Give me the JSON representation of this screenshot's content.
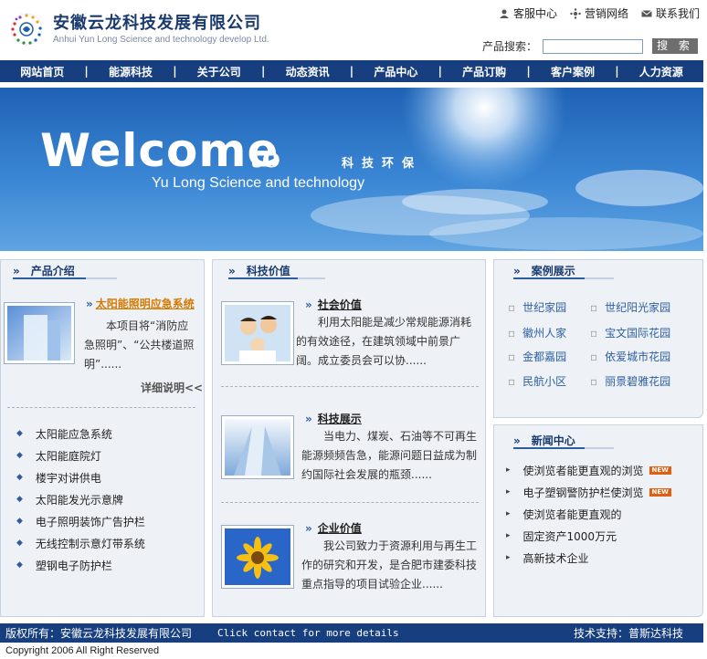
{
  "header": {
    "company_cn": "安徽云龙科技发展有限公司",
    "company_en": "Anhui Yun Long Science and technology develop Ltd.",
    "links": [
      "客服中心",
      "营销网络",
      "联系我们"
    ],
    "search_label": "产品搜索：",
    "search_value": "",
    "search_button": "搜 索"
  },
  "nav": [
    "网站首页",
    "能源科技",
    "关于公司",
    "动态资讯",
    "产品中心",
    "产品订购",
    "客户案例",
    "人力资源"
  ],
  "banner": {
    "welcome": "Welcome",
    "to": "to",
    "tagline": "科技环保",
    "subtitle": "Yu Long Science and technology"
  },
  "products": {
    "title": "产品介绍",
    "featured_title": "太阳能照明应急系统",
    "featured_text": "本项目将“消防应急照明”、“公共楼道照明”......",
    "more": "详细说明<<",
    "items": [
      "太阳能应急系统",
      "太阳能庭院灯",
      "楼宇对讲供电",
      "太阳能发光示意牌",
      "电子照明装饰广告护栏",
      "无线控制示意灯带系统",
      "塑钢电子防护栏"
    ]
  },
  "tech": {
    "title": "科技价值",
    "entries": [
      {
        "heading": "社会价值",
        "text": "利用太阳能是减少常规能源消耗的有效途径，在建筑领域中前景广阔。成立委员会可以协......"
      },
      {
        "heading": "科技展示",
        "text": "当电力、煤炭、石油等不可再生能源频频告急，能源问题日益成为制约国际社会发展的瓶颈......"
      },
      {
        "heading": "企业价值",
        "text": "我公司致力于资源利用与再生工作的研究和开发，是合肥市建委科技重点指导的项目试验企业......"
      }
    ]
  },
  "cases": {
    "title": "案例展示",
    "items": [
      "世纪家园",
      "世纪阳光家园",
      "徽州人家",
      "宝文国际花园",
      "金都嘉园",
      "依爱城市花园",
      "民航小区",
      "丽景碧雅花园"
    ]
  },
  "news": {
    "title": "新闻中心",
    "items": [
      {
        "text": "使浏览者能更直观的浏览",
        "badge": "NEW"
      },
      {
        "text": "电子塑钢警防护栏使浏览",
        "badge": "NEW"
      },
      {
        "text": "使浏览者能更直观的",
        "badge": ""
      },
      {
        "text": "固定资产1000万元",
        "badge": ""
      },
      {
        "text": "高新技术企业",
        "badge": ""
      }
    ]
  },
  "footer": {
    "rights": "版权所有：安徽云龙科技发展有限公司",
    "click": "Click contact for more details",
    "support": "技术支持：普斯达科技",
    "copyright": "Copyright 2006 All Right Reserved"
  }
}
